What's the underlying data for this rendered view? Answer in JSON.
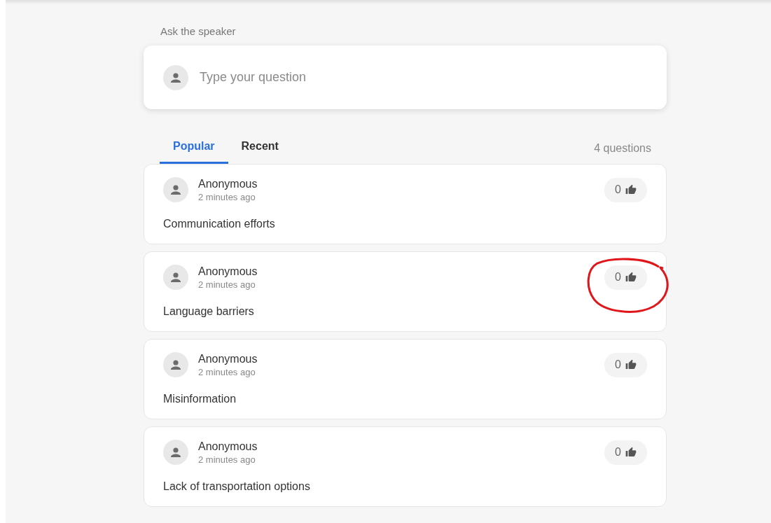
{
  "ask": {
    "label": "Ask the speaker",
    "placeholder": "Type your question"
  },
  "tabs": [
    {
      "label": "Popular",
      "selected": true
    },
    {
      "label": "Recent",
      "selected": false
    }
  ],
  "count": "4 questions",
  "questions": [
    {
      "author": "Anonymous",
      "time": "2 minutes ago",
      "text": "Communication efforts",
      "votes": "0",
      "circled": false
    },
    {
      "author": "Anonymous",
      "time": "2 minutes ago",
      "text": "Language barriers",
      "votes": "0",
      "circled": true
    },
    {
      "author": "Anonymous",
      "time": "2 minutes ago",
      "text": "Misinformation",
      "votes": "0",
      "circled": false
    },
    {
      "author": "Anonymous",
      "time": "2 minutes ago",
      "text": "Lack of transportation options",
      "votes": "0",
      "circled": false
    }
  ]
}
